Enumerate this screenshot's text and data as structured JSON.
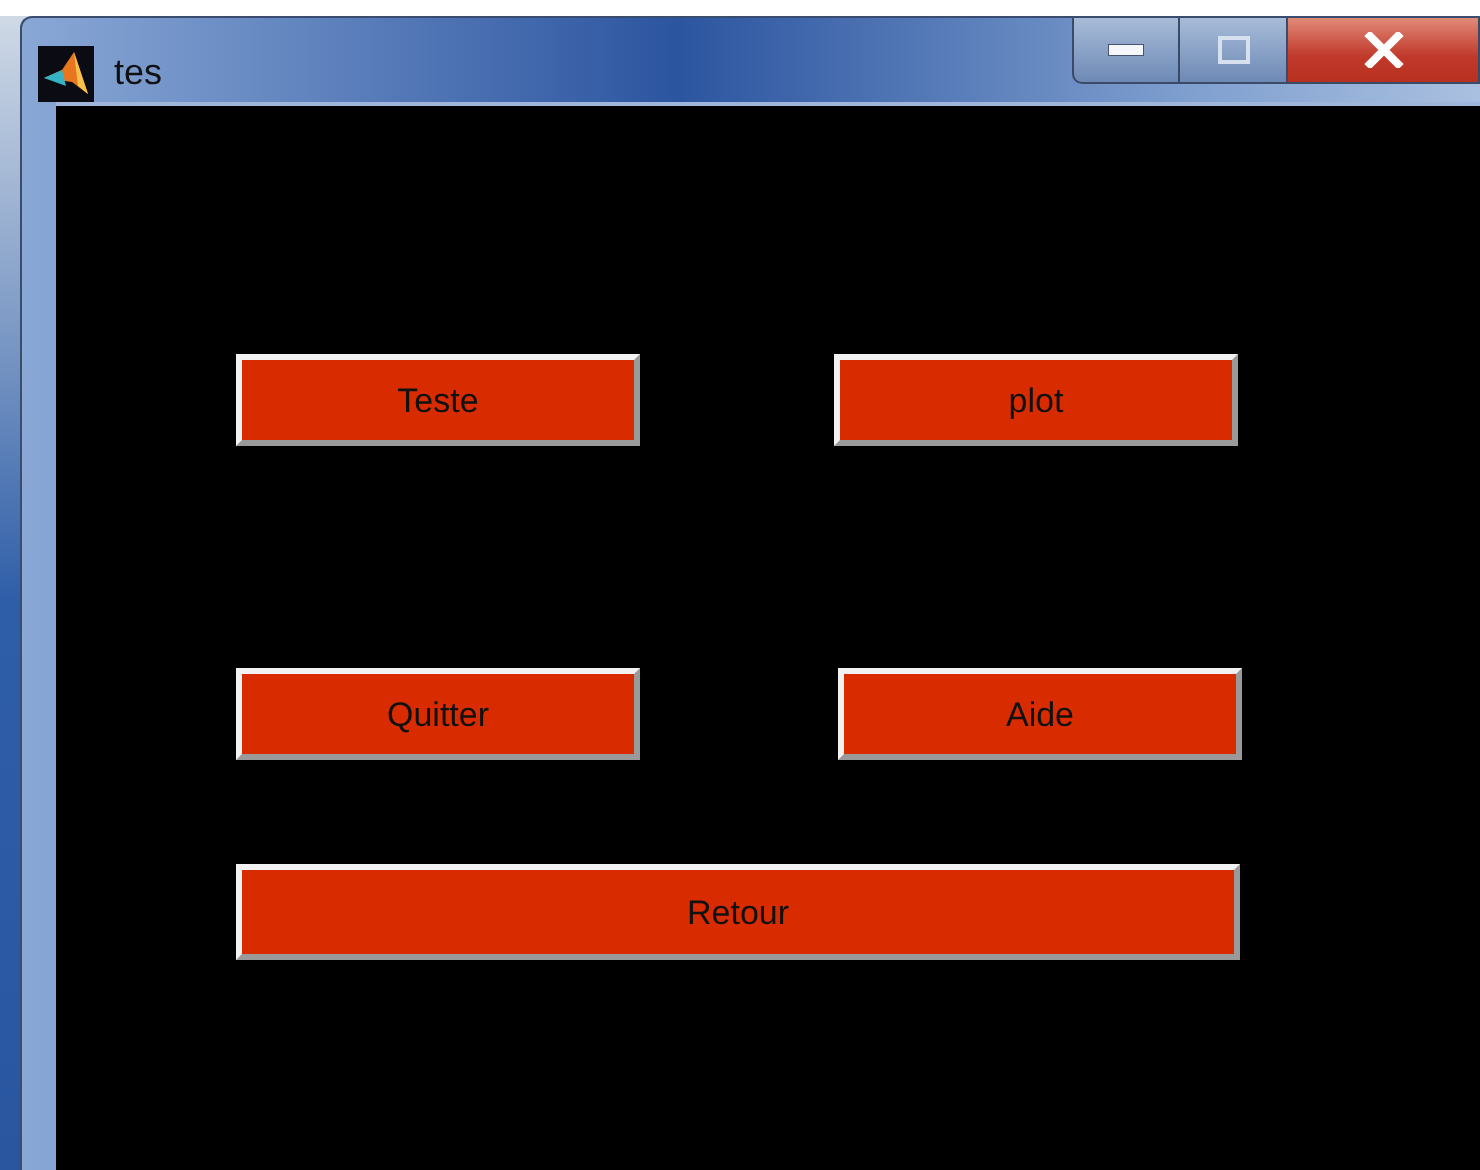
{
  "window": {
    "title": "tes"
  },
  "button_rows": [
    {
      "buttons": [
        {
          "label": "Teste"
        },
        {
          "label": "plot"
        }
      ]
    },
    {
      "buttons": [
        {
          "label": "Quitter"
        },
        {
          "label": "Aide"
        }
      ]
    },
    {
      "buttons": [
        {
          "label": "Retour"
        }
      ]
    }
  ]
}
